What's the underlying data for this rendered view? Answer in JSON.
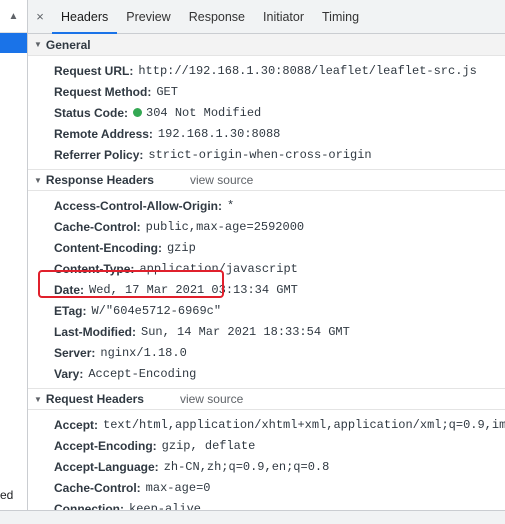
{
  "left_panel": {
    "scroll_up_glyph": "▲",
    "truncated_text": "ed"
  },
  "tabs": {
    "close_glyph": "×",
    "items": [
      {
        "label": "Headers"
      },
      {
        "label": "Preview"
      },
      {
        "label": "Response"
      },
      {
        "label": "Initiator"
      },
      {
        "label": "Timing"
      }
    ]
  },
  "general": {
    "title": "General",
    "request_url_key": "Request URL:",
    "request_url_val": "http://192.168.1.30:8088/leaflet/leaflet-src.js",
    "request_method_key": "Request Method:",
    "request_method_val": "GET",
    "status_code_key": "Status Code:",
    "status_code_val": "304 Not Modified",
    "status_color": "#34a853",
    "remote_address_key": "Remote Address:",
    "remote_address_val": "192.168.1.30:8088",
    "referrer_policy_key": "Referrer Policy:",
    "referrer_policy_val": "strict-origin-when-cross-origin"
  },
  "response_headers": {
    "title": "Response Headers",
    "view_source": "view source",
    "rows": [
      {
        "key": "Access-Control-Allow-Origin:",
        "val": "*"
      },
      {
        "key": "Cache-Control:",
        "val": "public,max-age=2592000"
      },
      {
        "key": "Content-Encoding:",
        "val": "gzip"
      },
      {
        "key": "Content-Type:",
        "val": "application/javascript"
      },
      {
        "key": "Date:",
        "val": "Wed, 17 Mar 2021 03:13:34 GMT"
      },
      {
        "key": "ETag:",
        "val": "W/\"604e5712-6969c\""
      },
      {
        "key": "Last-Modified:",
        "val": "Sun, 14 Mar 2021 18:33:54 GMT"
      },
      {
        "key": "Server:",
        "val": "nginx/1.18.0"
      },
      {
        "key": "Vary:",
        "val": "Accept-Encoding"
      }
    ]
  },
  "request_headers": {
    "title": "Request Headers",
    "view_source": "view source",
    "rows": [
      {
        "key": "Accept:",
        "val": "text/html,application/xhtml+xml,application/xml;q=0.9,im"
      },
      {
        "key": "Accept-Encoding:",
        "val": "gzip, deflate"
      },
      {
        "key": "Accept-Language:",
        "val": "zh-CN,zh;q=0.9,en;q=0.8"
      },
      {
        "key": "Cache-Control:",
        "val": "max-age=0"
      },
      {
        "key": "Connection:",
        "val": "keep-alive"
      }
    ]
  },
  "highlight_color": "#e0202c"
}
